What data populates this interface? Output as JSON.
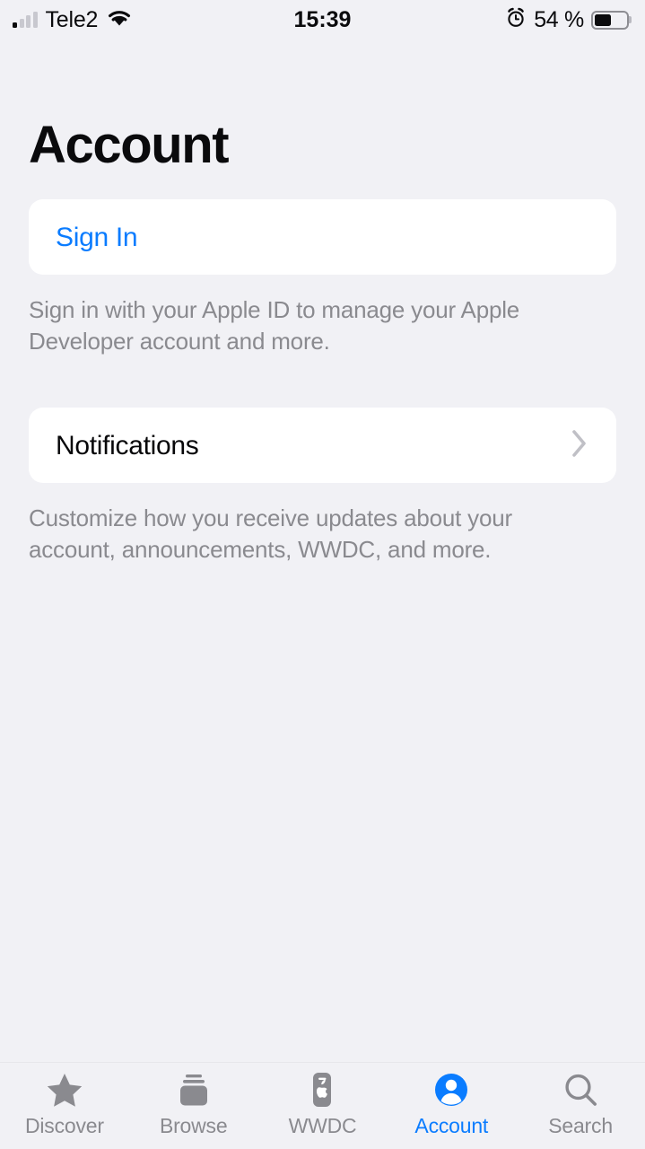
{
  "status_bar": {
    "carrier": "Tele2",
    "signal_icon": "signal-bars-icon",
    "signal_bars_filled": 1,
    "signal_bars_total": 4,
    "wifi_icon": "wifi-icon",
    "time": "15:39",
    "alarm_icon": "alarm-clock-icon",
    "battery_percent": "54 %",
    "battery_level": 54,
    "battery_icon": "battery-icon"
  },
  "header": {
    "title": "Account"
  },
  "sections": [
    {
      "row_label": "Sign In",
      "row_style": "link",
      "has_chevron": false,
      "note": "Sign in with your Apple ID to manage your Apple Developer account and more."
    },
    {
      "row_label": "Notifications",
      "row_style": "plain",
      "has_chevron": true,
      "chevron_icon": "chevron-right-icon",
      "note": "Customize how you receive updates about your account, announcements, WWDC, and more."
    }
  ],
  "tab_bar": {
    "active_index": 3,
    "tabs": [
      {
        "label": "Discover",
        "icon": "star-icon"
      },
      {
        "label": "Browse",
        "icon": "cards-stack-icon"
      },
      {
        "label": "WWDC",
        "icon": "device-apple-icon"
      },
      {
        "label": "Account",
        "icon": "person-circle-icon"
      },
      {
        "label": "Search",
        "icon": "magnifier-icon"
      }
    ]
  },
  "colors": {
    "background": "#f1f1f5",
    "card": "#ffffff",
    "accent": "#0a7cff",
    "secondary_text": "#8a8a8f",
    "primary_text": "#070709",
    "inactive_tab": "#8a8a8f"
  }
}
